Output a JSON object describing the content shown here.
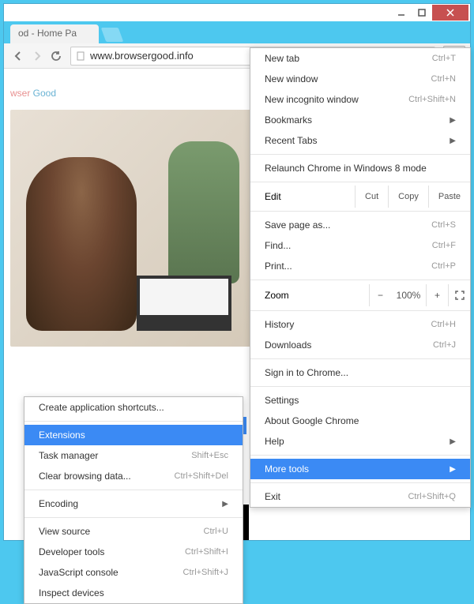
{
  "window": {
    "tab_title": "od - Home Pa",
    "url": "www.browsergood.info"
  },
  "page": {
    "logo_part1": "wser ",
    "logo_part2": "Good"
  },
  "menu": {
    "new_tab": "New tab",
    "new_tab_sc": "Ctrl+T",
    "new_window": "New window",
    "new_window_sc": "Ctrl+N",
    "new_incognito": "New incognito window",
    "new_incognito_sc": "Ctrl+Shift+N",
    "bookmarks": "Bookmarks",
    "recent_tabs": "Recent Tabs",
    "relaunch": "Relaunch Chrome in Windows 8 mode",
    "edit": "Edit",
    "cut": "Cut",
    "copy": "Copy",
    "paste": "Paste",
    "save_as": "Save page as...",
    "save_as_sc": "Ctrl+S",
    "find": "Find...",
    "find_sc": "Ctrl+F",
    "print": "Print...",
    "print_sc": "Ctrl+P",
    "zoom": "Zoom",
    "zoom_val": "100%",
    "history": "History",
    "history_sc": "Ctrl+H",
    "downloads": "Downloads",
    "downloads_sc": "Ctrl+J",
    "signin": "Sign in to Chrome...",
    "settings": "Settings",
    "about": "About Google Chrome",
    "help": "Help",
    "more_tools": "More tools",
    "exit": "Exit",
    "exit_sc": "Ctrl+Shift+Q"
  },
  "submenu": {
    "create_shortcuts": "Create application shortcuts...",
    "extensions": "Extensions",
    "task_manager": "Task manager",
    "task_manager_sc": "Shift+Esc",
    "clear_data": "Clear browsing data...",
    "clear_data_sc": "Ctrl+Shift+Del",
    "encoding": "Encoding",
    "view_source": "View source",
    "view_source_sc": "Ctrl+U",
    "dev_tools": "Developer tools",
    "dev_tools_sc": "Ctrl+Shift+I",
    "js_console": "JavaScript console",
    "js_console_sc": "Ctrl+Shift+J",
    "inspect_devices": "Inspect devices"
  },
  "watermark": ""
}
